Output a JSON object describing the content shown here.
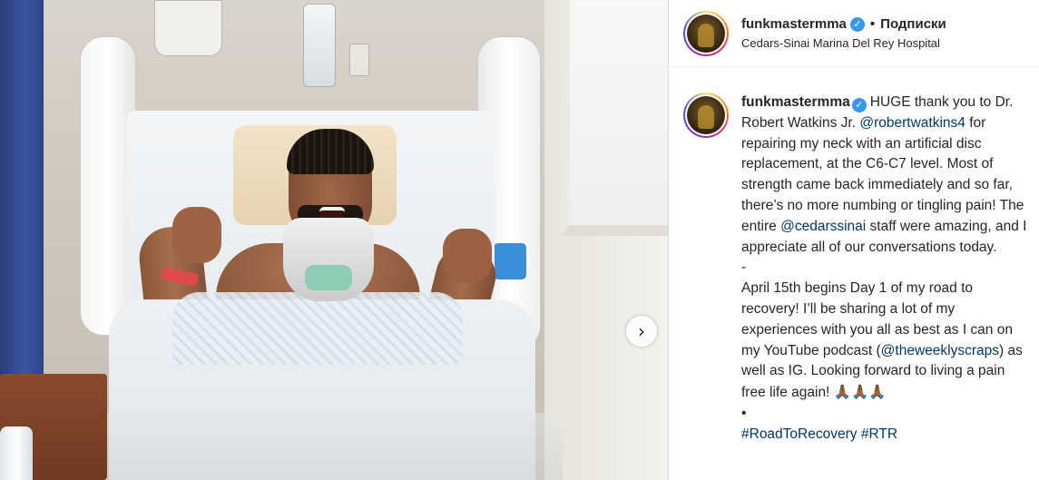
{
  "header": {
    "username": "funkmastermma",
    "separator": "•",
    "follow_status": "Подписки",
    "location": "Cedars-Sinai Marina Del Rey Hospital"
  },
  "media": {
    "next_icon": "chevron-right-icon"
  },
  "caption": {
    "username": "funkmastermma",
    "p1_a": "HUGE thank you to Dr. Robert Watkins Jr. ",
    "mention1": "@robertwatkins4",
    "p1_b": " for repairing my neck with an artificial disc replacement, at the C6-C7 level. Most of strength came back immediately and so far, there’s no more numbing or tingling pain! The entire ",
    "mention2": "@cedarssinai",
    "p1_c": " staff were amazing, and I appreciate all of our conversations today.",
    "dash": "-",
    "p2_a": "April 15th begins Day 1 of my road to recovery! I’ll be sharing a lot of my experiences with you all as best as I can on my YouTube podcast (",
    "mention3": "@theweeklyscraps",
    "p2_b": ") as well as IG. Looking forward to living a pain free life again! ",
    "emojis": "🙏🏾🙏🏾🙏🏾",
    "bullet": "•",
    "hashtag1": "#RoadToRecovery",
    "hashtag2": "#RTR"
  },
  "colors": {
    "link": "#00376b",
    "verified": "#3897f0",
    "text": "#262626",
    "divider": "#dbdbdb"
  }
}
